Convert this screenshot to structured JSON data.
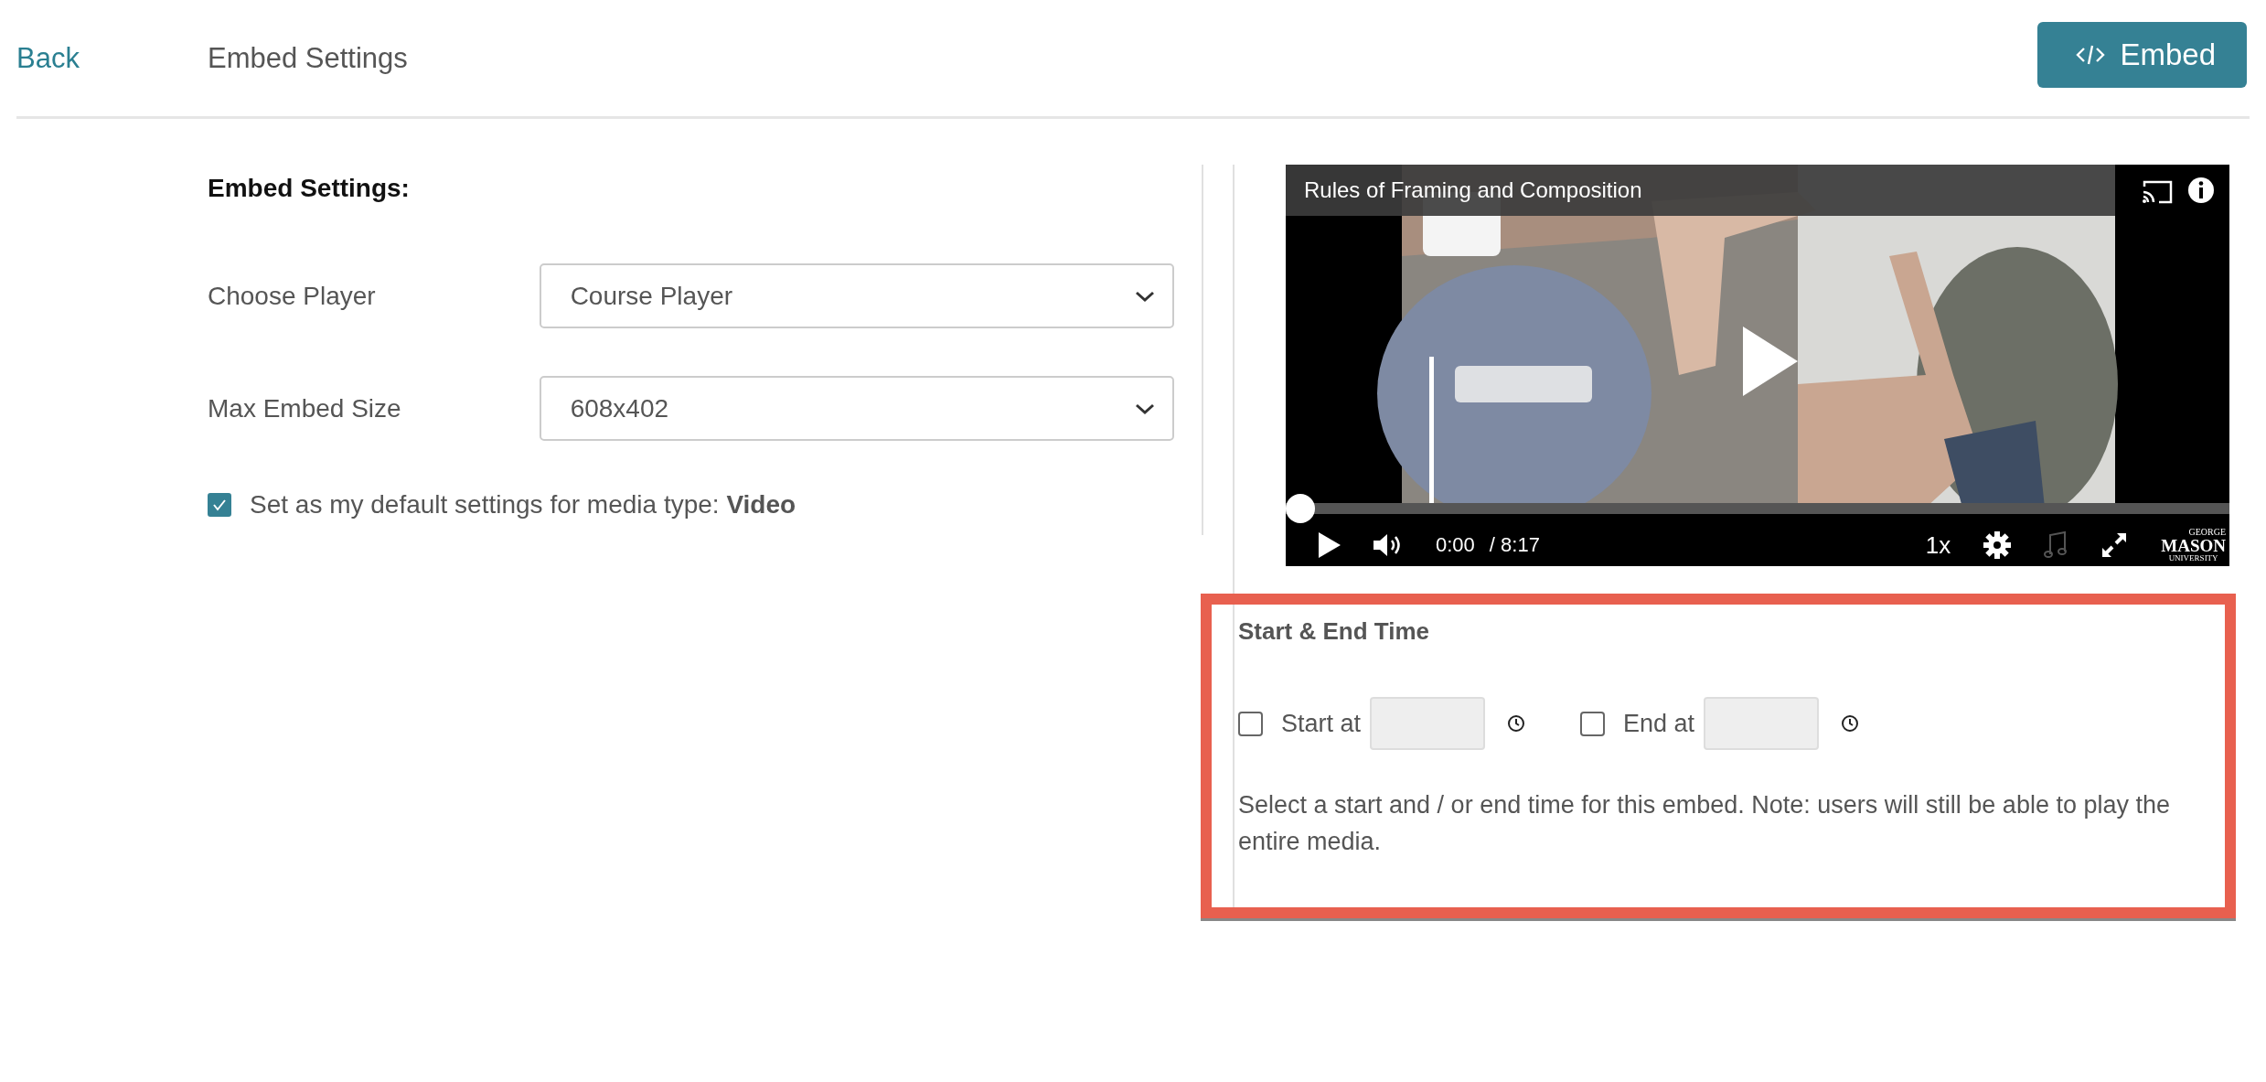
{
  "header": {
    "back_link": "Back",
    "title": "Embed Settings",
    "embed_button": "Embed"
  },
  "settings": {
    "heading": "Embed Settings:",
    "fields": [
      {
        "label": "Choose Player",
        "value": "Course Player"
      },
      {
        "label": "Max Embed Size",
        "value": "608x402"
      }
    ],
    "default_checkbox": {
      "label": "Set as my default settings for media type: **Video**",
      "checked": true
    }
  },
  "player": {
    "title": "Rules of Framing and Composition",
    "progress": {
      "level": 0
    },
    "current_time": "0:00",
    "duration": "/ 8:17",
    "speed": "1x",
    "logo": [
      "GEORGE",
      "MASON",
      "UNIVERSITY"
    ]
  },
  "start_end": {
    "heading": "Start & End Time",
    "times": [
      {
        "label": "Start at",
        "checked": false
      },
      {
        "label": "End at",
        "checked": false
      }
    ],
    "note": "Select a start and / or end time for this embed. Note: users will still be able to play the entire media."
  }
}
